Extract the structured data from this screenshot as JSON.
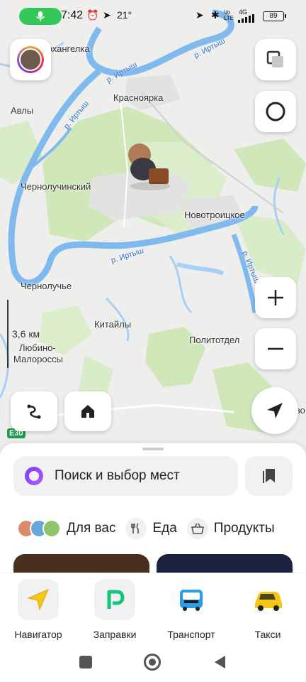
{
  "status_bar": {
    "time": "7:42",
    "temperature": "21°",
    "network": "4G",
    "volte": "Vo LTE",
    "battery": "89"
  },
  "map": {
    "rivers": [
      "р. Иртыш",
      "р. Иртыш",
      "р. Иртыш",
      "р. Иртыш",
      "р. Иртыш"
    ],
    "places": {
      "arkhangelka": "Архангелка",
      "avly": "Авлы",
      "krasnoyarka": "Красноярка",
      "chernoluchinsky": "Чернолучинский",
      "novotroitskoe": "Новотроицкое",
      "chernoluchye": "Чернолучье",
      "kitayly": "Китайлы",
      "politotdel": "Политотдел",
      "lyubino": "Любино-",
      "malorossy": "Малороссы",
      "edge_label": "егово"
    },
    "scale": "3,6 км",
    "road_badge": "E30"
  },
  "sheet": {
    "search_placeholder": "Поиск и выбор мест",
    "chips": [
      {
        "label": "Для вас",
        "icon": "avatars-icon"
      },
      {
        "label": "Еда",
        "icon": "fork-knife-icon"
      },
      {
        "label": "Продукты",
        "icon": "basket-icon"
      }
    ]
  },
  "apps": [
    {
      "label": "Навигатор",
      "icon": "navigator-arrow-icon"
    },
    {
      "label": "Заправки",
      "icon": "fuel-p-icon"
    },
    {
      "label": "Транспорт",
      "icon": "bus-icon"
    },
    {
      "label": "Такси",
      "icon": "taxi-car-icon"
    }
  ],
  "colors": {
    "accent_green": "#34c85a",
    "river": "#7fb9ee",
    "forest": "#c9e4b3",
    "alice": "#8a45f5"
  }
}
